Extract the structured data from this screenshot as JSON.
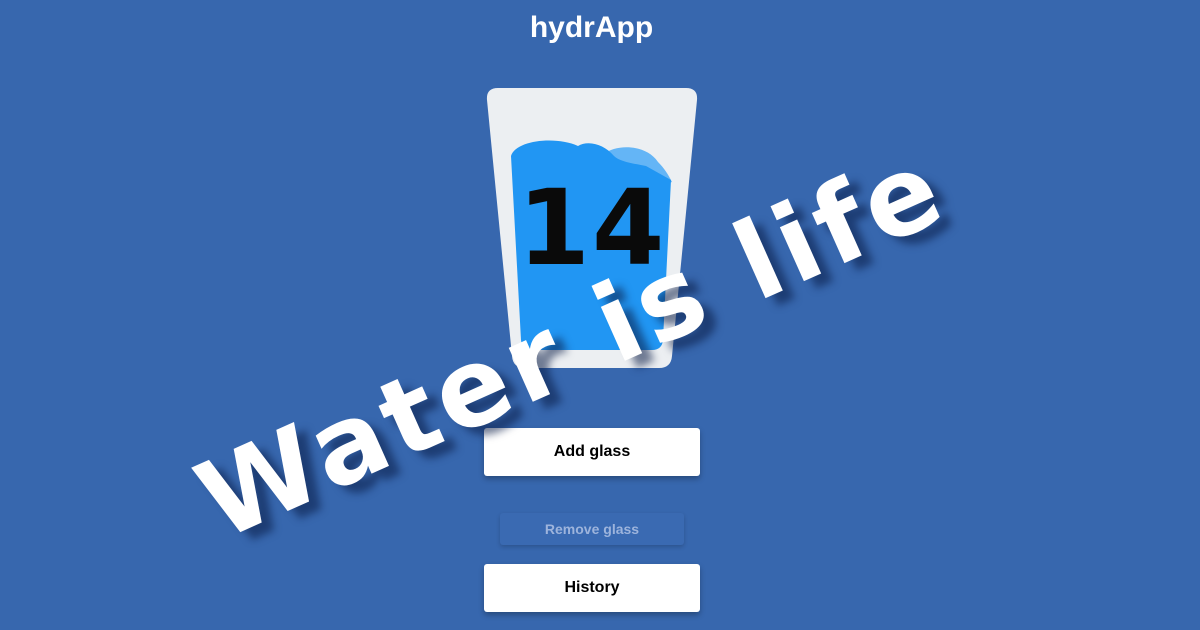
{
  "app": {
    "title": "hydrApp"
  },
  "counter": {
    "glasses": "14"
  },
  "slogan": "Water is life",
  "buttons": {
    "add": "Add glass",
    "remove": "Remove glass",
    "history": "History"
  },
  "colors": {
    "background": "#3767ae",
    "glass": "#eceff2",
    "water": "#2196f3",
    "water_light": "#62b1f5"
  },
  "icons": {
    "glass": "water-glass-icon"
  }
}
